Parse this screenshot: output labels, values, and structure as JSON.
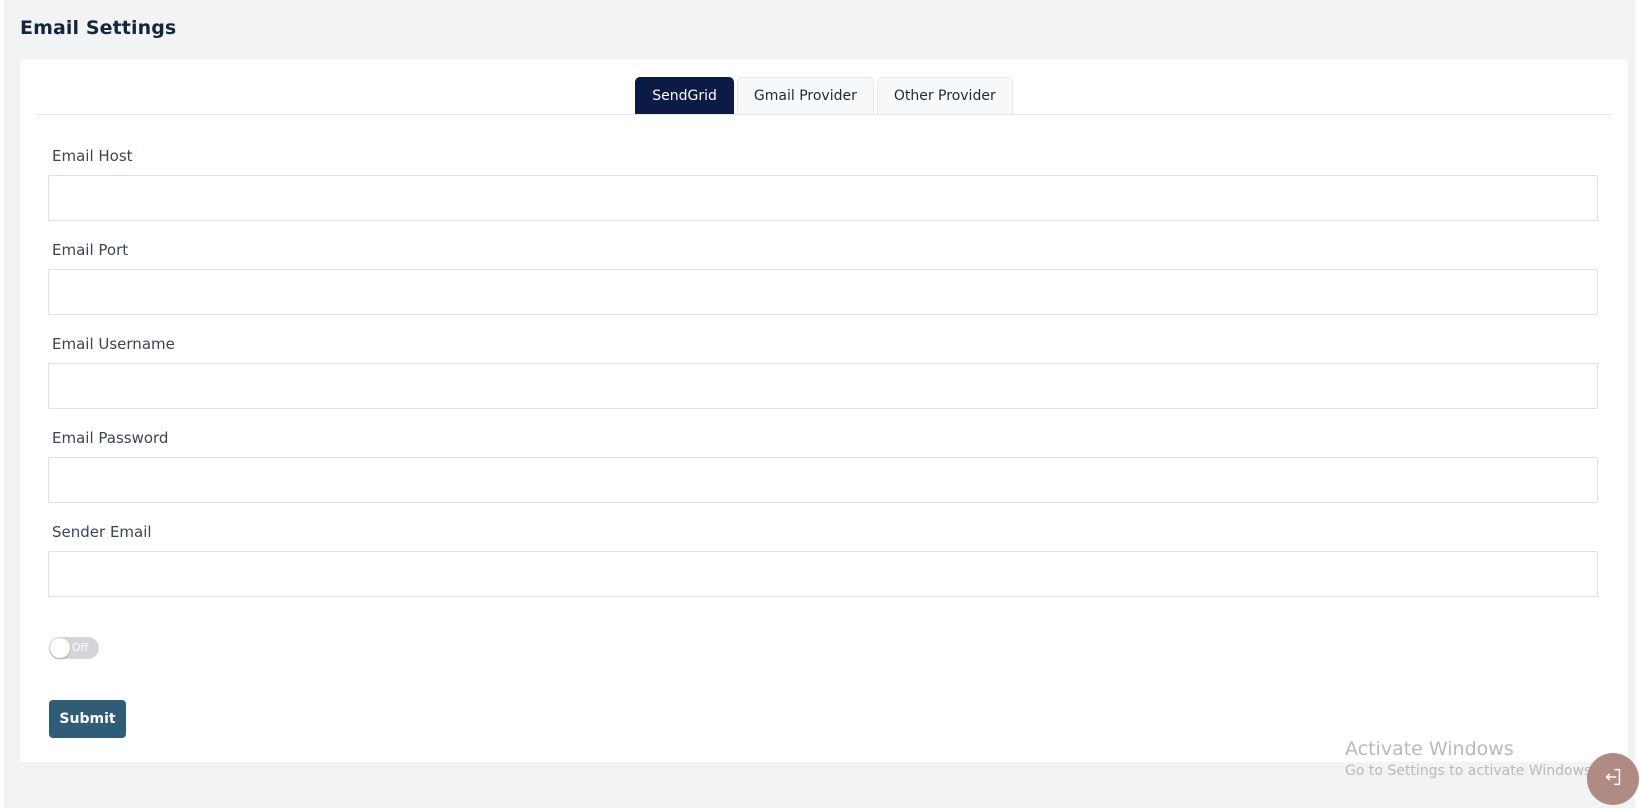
{
  "page": {
    "title": "Email Settings"
  },
  "tabs": [
    {
      "label": "SendGrid",
      "active": true
    },
    {
      "label": "Gmail Provider",
      "active": false
    },
    {
      "label": "Other Provider",
      "active": false
    }
  ],
  "form": {
    "fields": [
      {
        "label": "Email Host",
        "value": ""
      },
      {
        "label": "Email Port",
        "value": ""
      },
      {
        "label": "Email Username",
        "value": ""
      },
      {
        "label": "Email Password",
        "value": ""
      },
      {
        "label": "Sender Email",
        "value": ""
      }
    ],
    "toggle": {
      "label": "Off",
      "state": false
    },
    "submit_label": "Submit"
  },
  "watermark": {
    "title": "Activate Windows",
    "subtitle": "Go to Settings to activate Windows."
  },
  "fab": {
    "icon": "logout-icon"
  },
  "colors": {
    "active_tab": "#0c1b45",
    "submit_button": "#2f5d78",
    "fab": "#b08b86",
    "page_background": "#f2f3f5"
  }
}
